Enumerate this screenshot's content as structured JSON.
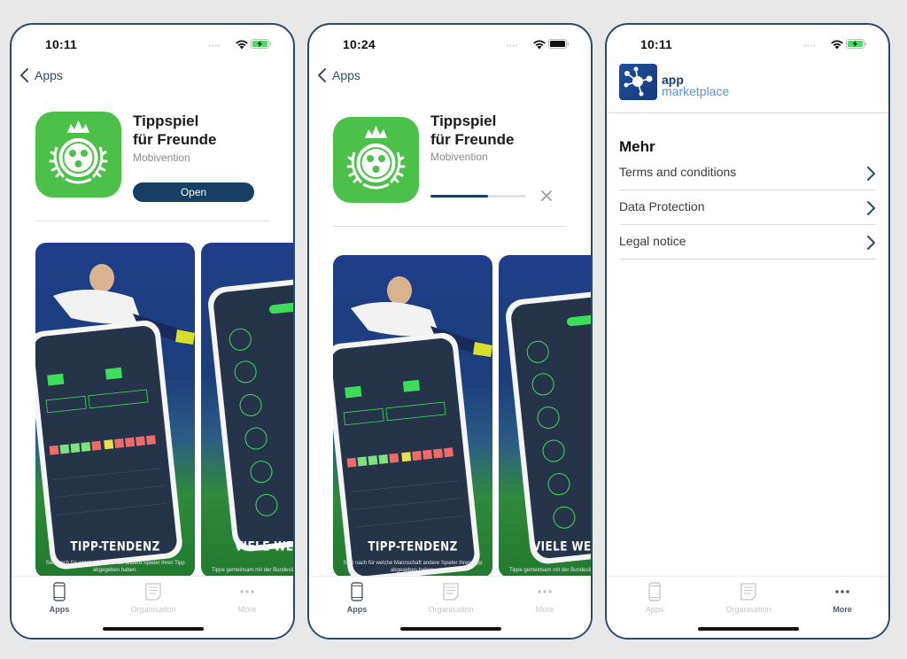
{
  "phones": [
    {
      "status": {
        "time": "10:11",
        "battery": "charging"
      },
      "nav": {
        "back_label": "Apps"
      },
      "app": {
        "title_line1": "Tippspiel",
        "title_line2": "für Freunde",
        "developer": "Mobivention",
        "action_label": "Open"
      },
      "screenshots": [
        {
          "caption": "TIPP-TENDENZ",
          "subtitle": "Sieh nach für welche Mannschaft andere Spieler ihren Tipp abgegeben haben."
        },
        {
          "caption": "VIELE WETT",
          "subtitle": "Tippe gemeinsam mit der Bundesliga und die"
        }
      ],
      "tabs": [
        {
          "label": "Apps",
          "icon": "phone-icon",
          "active": true
        },
        {
          "label": "Organisation",
          "icon": "list-icon",
          "active": false
        },
        {
          "label": "More",
          "icon": "more-dots-icon",
          "active": false
        }
      ]
    },
    {
      "status": {
        "time": "10:24",
        "battery": "full"
      },
      "nav": {
        "back_label": "Apps"
      },
      "app": {
        "title_line1": "Tippspiel",
        "title_line2": "für Freunde",
        "developer": "Mobivention",
        "download_progress": 0.6
      },
      "screenshots": [
        {
          "caption": "TIPP-TENDENZ",
          "subtitle": "Sieh nach für welche Mannschaft andere Spieler ihren Tipp abgegeben haben."
        },
        {
          "caption": "VIELE WETT",
          "subtitle": "Tippe gemeinsam mit der Bundesliga und die"
        }
      ],
      "tabs": [
        {
          "label": "Apps",
          "icon": "phone-icon",
          "active": true
        },
        {
          "label": "Organisation",
          "icon": "list-icon",
          "active": false
        },
        {
          "label": "More",
          "icon": "more-dots-icon",
          "active": false
        }
      ]
    },
    {
      "status": {
        "time": "10:11",
        "battery": "charging"
      },
      "brand": {
        "line1": "app",
        "line2": "marketplace"
      },
      "section_title": "Mehr",
      "items": [
        {
          "label": "Terms and conditions"
        },
        {
          "label": "Data Protection"
        },
        {
          "label": "Legal notice"
        }
      ],
      "tabs": [
        {
          "label": "Apps",
          "icon": "phone-icon",
          "active": false
        },
        {
          "label": "Organisation",
          "icon": "list-icon",
          "active": false
        },
        {
          "label": "More",
          "icon": "more-dots-icon",
          "active": true
        }
      ]
    }
  ],
  "colors": {
    "accent": "#173e63",
    "app_icon_green": "#4cc14a",
    "frame": "#2b4a66",
    "brand_blue": "#5a8fd8"
  }
}
